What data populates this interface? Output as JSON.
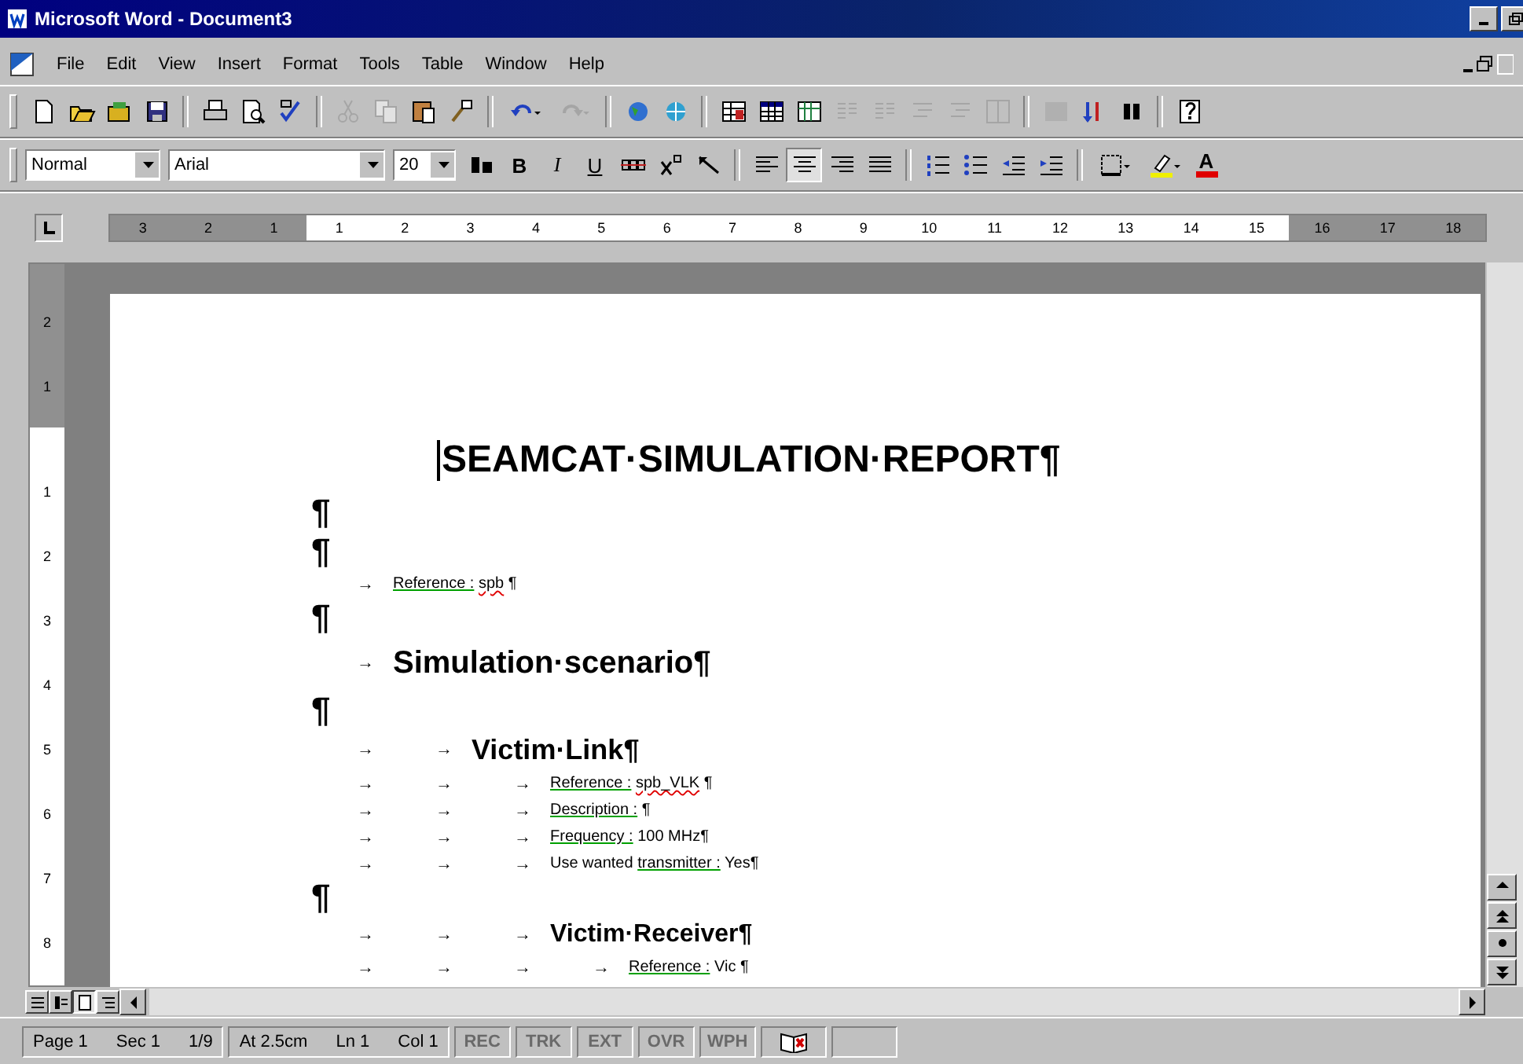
{
  "window": {
    "title": "Microsoft Word - Document3"
  },
  "menu": [
    {
      "label": "File"
    },
    {
      "label": "Edit"
    },
    {
      "label": "View"
    },
    {
      "label": "Insert"
    },
    {
      "label": "Format"
    },
    {
      "label": "Tools"
    },
    {
      "label": "Table"
    },
    {
      "label": "Window"
    },
    {
      "label": "Help"
    }
  ],
  "standard_toolbar": [
    {
      "kind": "new",
      "disabled": false
    },
    {
      "kind": "open",
      "disabled": false
    },
    {
      "kind": "folder",
      "disabled": false
    },
    {
      "kind": "save",
      "disabled": false
    },
    {
      "kind": "sep"
    },
    {
      "kind": "print",
      "disabled": false
    },
    {
      "kind": "preview",
      "disabled": false
    },
    {
      "kind": "spell",
      "disabled": false
    },
    {
      "kind": "sep"
    },
    {
      "kind": "cut",
      "disabled": true
    },
    {
      "kind": "copy",
      "disabled": true
    },
    {
      "kind": "paste",
      "disabled": false
    },
    {
      "kind": "brush",
      "disabled": false
    },
    {
      "kind": "sep"
    },
    {
      "kind": "undo",
      "disabled": false
    },
    {
      "kind": "redo",
      "disabled": true
    },
    {
      "kind": "sep"
    },
    {
      "kind": "globe",
      "disabled": false
    },
    {
      "kind": "web",
      "disabled": false
    },
    {
      "kind": "sep"
    },
    {
      "kind": "table",
      "disabled": false
    },
    {
      "kind": "grid",
      "disabled": false
    },
    {
      "kind": "sheet",
      "disabled": false
    },
    {
      "kind": "columns",
      "disabled": true
    },
    {
      "kind": "columns",
      "disabled": true
    },
    {
      "kind": "lines",
      "disabled": true
    },
    {
      "kind": "lines",
      "disabled": true
    },
    {
      "kind": "bar",
      "disabled": true
    },
    {
      "kind": "sep"
    },
    {
      "kind": "map",
      "disabled": true
    },
    {
      "kind": "sort",
      "disabled": false
    },
    {
      "kind": "pause",
      "disabled": false
    },
    {
      "kind": "sep"
    },
    {
      "kind": "help",
      "disabled": false
    }
  ],
  "formatting_toolbar": {
    "style": "Normal",
    "font": "Arial",
    "size": "20",
    "buttons": [
      {
        "kind": "styles",
        "disabled": false
      },
      {
        "kind": "bold",
        "label": "B",
        "selected": false
      },
      {
        "kind": "italic",
        "label": "I",
        "selected": false
      },
      {
        "kind": "underline",
        "label": "U",
        "selected": false
      },
      {
        "kind": "strike",
        "disabled": false
      },
      {
        "kind": "superscript",
        "disabled": false
      },
      {
        "kind": "clear",
        "disabled": false
      },
      {
        "kind": "sep"
      },
      {
        "kind": "align-left",
        "selected": false
      },
      {
        "kind": "align-center",
        "selected": true
      },
      {
        "kind": "align-right",
        "selected": false
      },
      {
        "kind": "justify",
        "selected": false
      },
      {
        "kind": "sep"
      },
      {
        "kind": "numbering",
        "disabled": false
      },
      {
        "kind": "bullets",
        "disabled": false
      },
      {
        "kind": "outdent",
        "disabled": false
      },
      {
        "kind": "indent",
        "disabled": false
      },
      {
        "kind": "sep"
      },
      {
        "kind": "border",
        "disabled": false
      },
      {
        "kind": "highlight",
        "disabled": false
      },
      {
        "kind": "font-color",
        "label": "A"
      }
    ]
  },
  "ruler": {
    "left_margin_marks": [
      "3",
      "2",
      "1"
    ],
    "text_marks": [
      "1",
      "2",
      "3",
      "4",
      "5",
      "6",
      "7",
      "8",
      "9",
      "10",
      "11",
      "12",
      "13",
      "14",
      "15"
    ],
    "right_margin_marks": [
      "16",
      "17",
      "18"
    ]
  },
  "vertical_ruler": {
    "top_margin_marks": [
      "2",
      "1"
    ],
    "text_marks": [
      "1",
      "2",
      "3",
      "4",
      "5",
      "6",
      "7",
      "8"
    ]
  },
  "document": {
    "paragraphs": [
      {
        "kind": "title",
        "text": "SEAMCAT·SIMULATION·REPORT¶"
      },
      {
        "kind": "empty",
        "text": "¶"
      },
      {
        "kind": "empty",
        "text": "¶"
      },
      {
        "kind": "field",
        "tabs": [
          "→"
        ],
        "label": "Reference :",
        "value": "spb",
        "value_error": true,
        "end": " ¶"
      },
      {
        "kind": "empty",
        "text": "¶"
      },
      {
        "kind": "h1",
        "tabs": [
          "→"
        ],
        "text": "Simulation·scenario¶"
      },
      {
        "kind": "empty",
        "text": "¶"
      },
      {
        "kind": "h2",
        "tabs": [
          "→",
          "→"
        ],
        "text": "Victim·Link¶"
      },
      {
        "kind": "field",
        "tabs": [
          "→",
          "→",
          "→"
        ],
        "label": "Reference :",
        "value": "spb_VLK",
        "value_error": true,
        "end": " ¶"
      },
      {
        "kind": "field",
        "tabs": [
          "→",
          "→",
          "→"
        ],
        "label": "Description :",
        "end": " ¶"
      },
      {
        "kind": "field",
        "tabs": [
          "→",
          "→",
          "→"
        ],
        "label": "Frequency :",
        "value": "100 MHz",
        "value_error": false,
        "end": "¶"
      },
      {
        "kind": "field",
        "tabs": [
          "→",
          "→",
          "→"
        ],
        "prefix": "Use wanted ",
        "label": "transmitter :",
        "value": "Yes",
        "value_error": false,
        "end": "¶"
      },
      {
        "kind": "empty",
        "text": "¶"
      },
      {
        "kind": "h3",
        "tabs": [
          "→",
          "→",
          "→"
        ],
        "text": "Victim·Receiver¶"
      },
      {
        "kind": "field",
        "tabs": [
          "→",
          "→",
          "→",
          "→"
        ],
        "label": "Reference :",
        "value": "Vic",
        "value_error": false,
        "end": " ¶"
      }
    ]
  },
  "view_buttons": [
    {
      "kind": "normal",
      "selected": false
    },
    {
      "kind": "online",
      "selected": false
    },
    {
      "kind": "page",
      "selected": true
    },
    {
      "kind": "outline",
      "selected": false
    }
  ],
  "status_bar": {
    "fields": [
      {
        "text": "Page 1"
      },
      {
        "text": "Sec 1"
      },
      {
        "text": "1/9"
      },
      {
        "text": "At 2.5cm"
      },
      {
        "text": "Ln 1"
      },
      {
        "text": "Col 1"
      }
    ],
    "modes": [
      {
        "label": "REC",
        "disabled": true
      },
      {
        "label": "TRK",
        "disabled": true
      },
      {
        "label": "EXT",
        "disabled": true
      },
      {
        "label": "OVR",
        "disabled": true
      },
      {
        "label": "WPH",
        "disabled": true
      }
    ]
  }
}
